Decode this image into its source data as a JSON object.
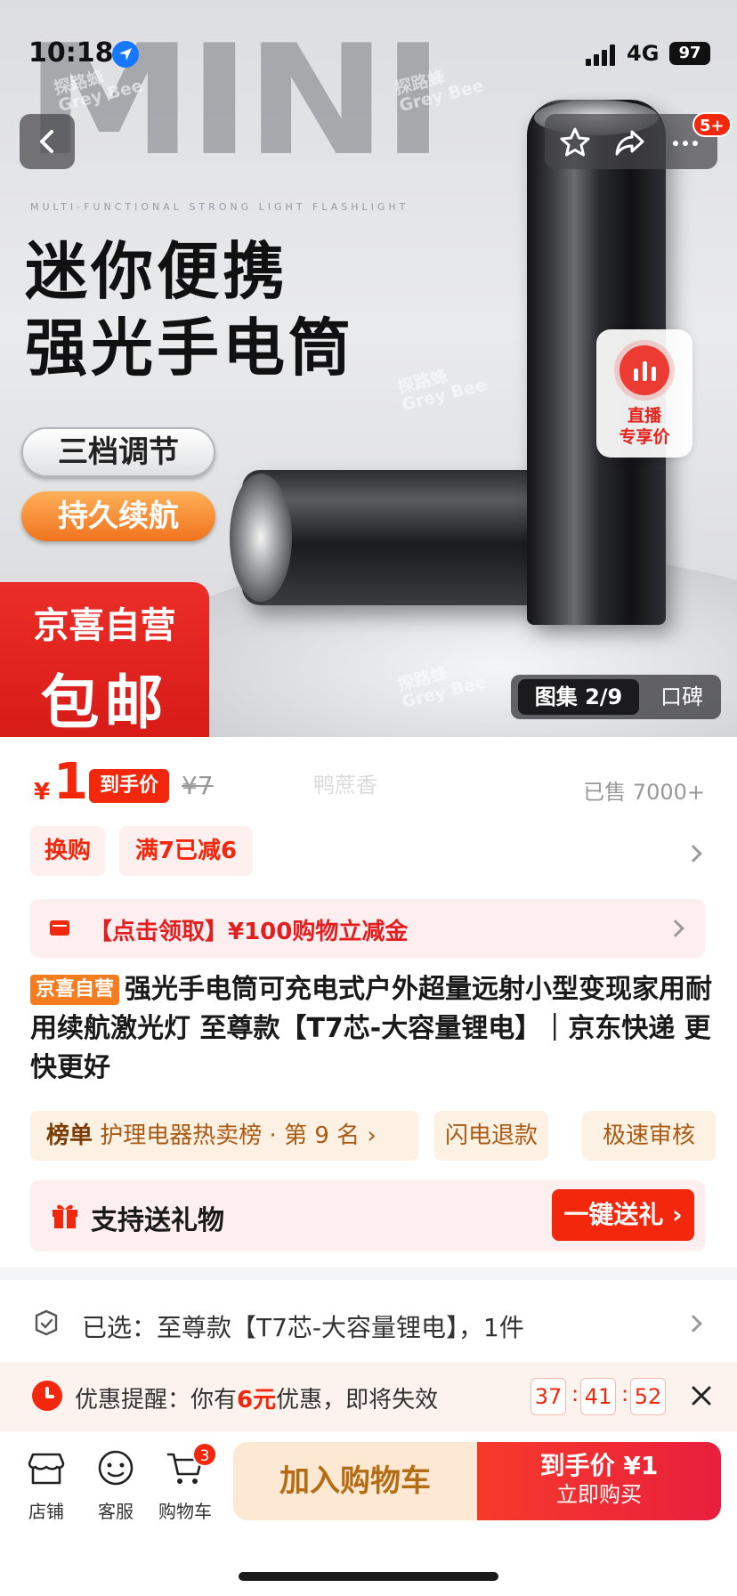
{
  "status_bar": {
    "time": "10:18",
    "network": "4G",
    "battery": "97"
  },
  "hero": {
    "watermark_big": "MINI",
    "watermark_sub": "MULTI-FUNCTIONAL STRONG LIGHT FLASHLIGHT",
    "watermark_brand_cn": "探路蜂",
    "watermark_brand_en": "Grey Bee",
    "title_line1": "迷你便携",
    "title_line2": "强光手电筒",
    "pill1": "三档调节",
    "pill2": "持久续航",
    "badge_line1": "京喜自营",
    "badge_line2": "包邮",
    "notification_count": "5+",
    "live_line1": "直播",
    "live_line2": "专享价",
    "gallery_label": "图集 2/9",
    "review_label": "口碑"
  },
  "price": {
    "currency": "¥",
    "value": "1",
    "tag": "到手价",
    "original": "¥7",
    "watermark": "鸭蔗香",
    "sold": "已售 7000+"
  },
  "promos": [
    "换购",
    "满7已减6"
  ],
  "coupon": {
    "text": "【点击领取】¥100购物立减金"
  },
  "product": {
    "badge": "京喜自营",
    "title": "强光手电筒可充电式户外超量远射小型变现家用耐用续航激光灯 至尊款【T7芯-大容量锂电】｜京东快递 更快更好"
  },
  "rank": {
    "label": "榜单",
    "text": "护理电器热卖榜 · 第 9 名",
    "chip2": "闪电退款",
    "chip3": "极速审核"
  },
  "gift": {
    "text": "支持送礼物",
    "button": "一键送礼"
  },
  "selected": {
    "text": "已选：至尊款【T7芯-大容量锂电】，1件"
  },
  "reminder": {
    "prefix": "优惠提醒：你有",
    "amount": "6元",
    "suffix": "优惠，即将失效",
    "h": "37",
    "m": "41",
    "s": "52"
  },
  "bottom": {
    "shop": "店铺",
    "service": "客服",
    "cart": "购物车",
    "cart_count": "3",
    "add_cart": "加入购物车",
    "buy_line1": "到手价 ¥1",
    "buy_line2": "立即购买"
  },
  "colors": {
    "accent": "#f2270c",
    "orange": "#f57c1f",
    "cart_btn": "#fde8d4"
  }
}
